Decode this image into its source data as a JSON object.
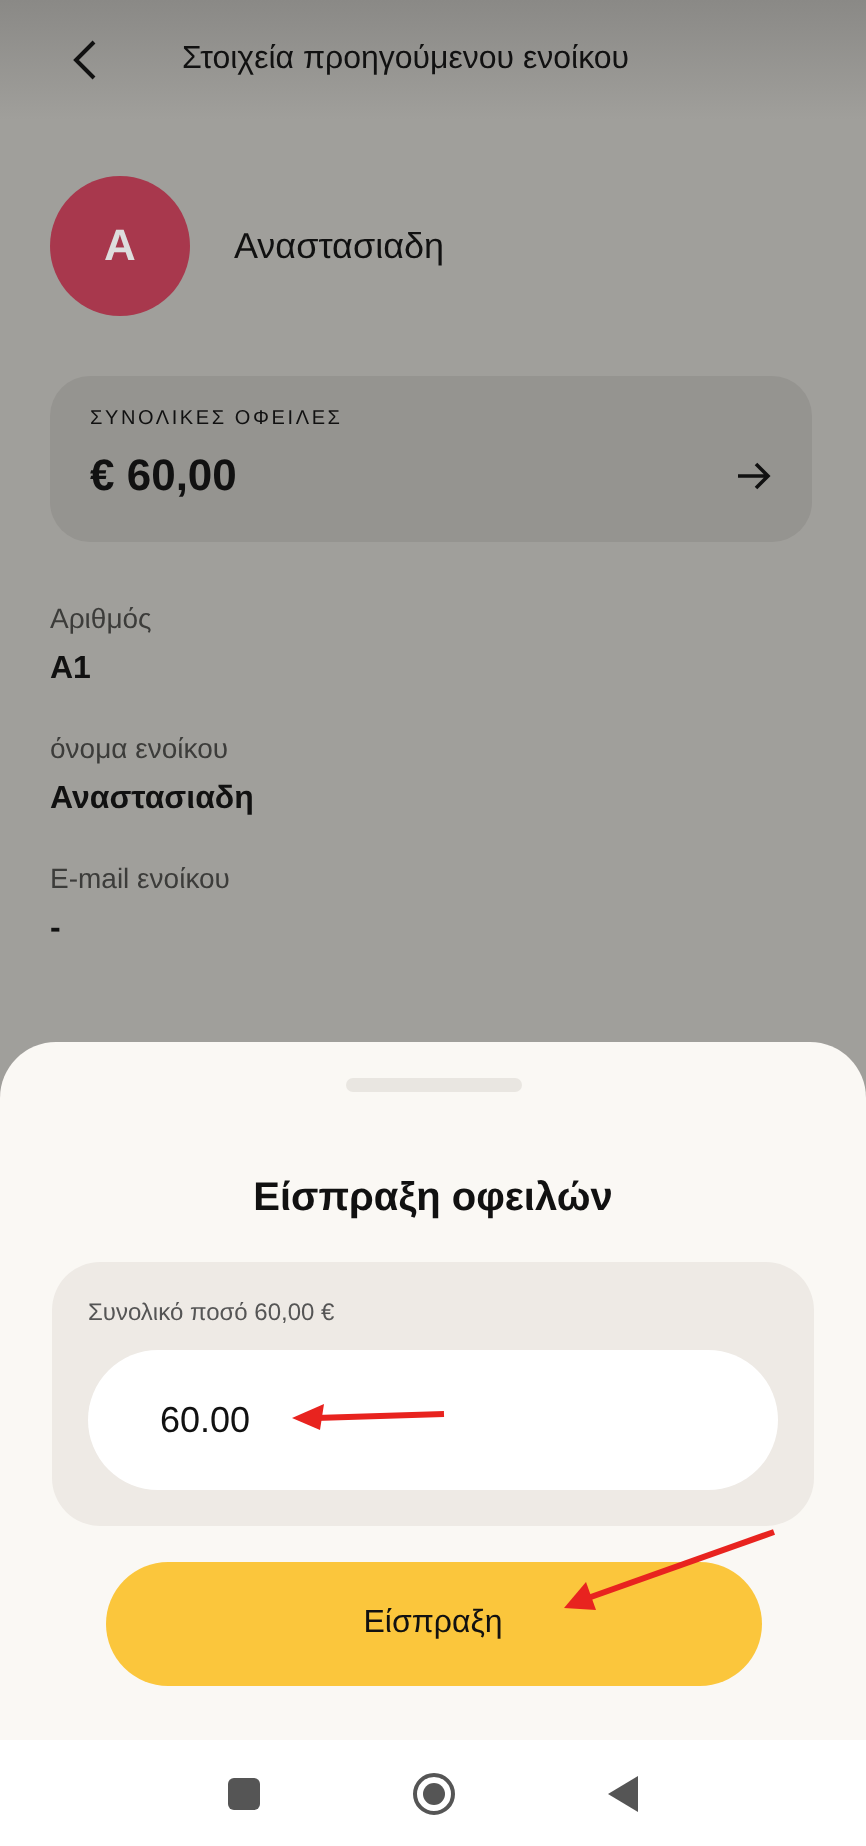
{
  "header": {
    "title": "Στοιχεία προηγούμενου ενοίκου"
  },
  "tenant": {
    "initial": "A",
    "name": "Αναστασιαδη"
  },
  "debts_card": {
    "label": "ΣΥΝΟΛΙΚΕΣ ΟΦΕΙΛΕΣ",
    "amount": "€ 60,00"
  },
  "fields": [
    {
      "label": "Αριθμός",
      "value": "A1"
    },
    {
      "label": "όνομα ενοίκου",
      "value": "Αναστασιαδη"
    },
    {
      "label": "E-mail ενοίκου",
      "value": "-"
    }
  ],
  "sheet": {
    "title": "Είσπραξη οφειλών",
    "total_label": "Συνολικό ποσό 60,00 €",
    "amount_value": "60.00",
    "button": "Είσπραξη"
  }
}
